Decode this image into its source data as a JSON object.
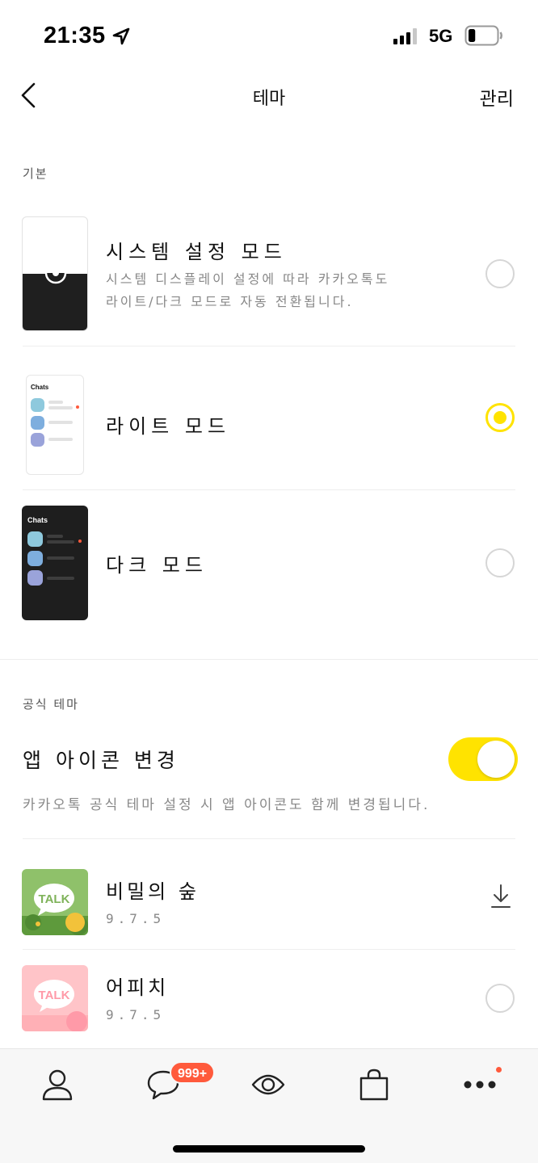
{
  "status_bar": {
    "time": "21:35",
    "network": "5G",
    "battery_level": 0.25
  },
  "nav": {
    "title": "테마",
    "action_label": "관리"
  },
  "sections": {
    "basic_label": "기본",
    "official_label": "공식 테마"
  },
  "modes": [
    {
      "title": "시스템 설정 모드",
      "desc_line1": "시스템 디스플레이 설정에 따라 카카오톡도",
      "desc_line2": "라이트/다크 모드로 자동 전환됩니다.",
      "selected": false
    },
    {
      "title": "라이트 모드",
      "selected": true,
      "thumb_label": "Chats"
    },
    {
      "title": "다크 모드",
      "selected": false,
      "thumb_label": "Chats"
    }
  ],
  "app_icon_toggle": {
    "title": "앱 아이콘 변경",
    "desc": "카카오톡 공식 테마 설정 시 앱 아이콘도 함께 변경됩니다.",
    "on": true
  },
  "themes": [
    {
      "name": "비밀의 숲",
      "version": "9.7.5",
      "thumb_label": "TALK",
      "action": "download-icon"
    },
    {
      "name": "어피치",
      "version": "9.7.5",
      "thumb_label": "TALK",
      "action": "radio"
    }
  ],
  "tab_bar": {
    "chat_badge": "999+"
  },
  "colors": {
    "accent": "#ffe300",
    "badge": "#ff5a3c",
    "muted_text": "#888888"
  }
}
